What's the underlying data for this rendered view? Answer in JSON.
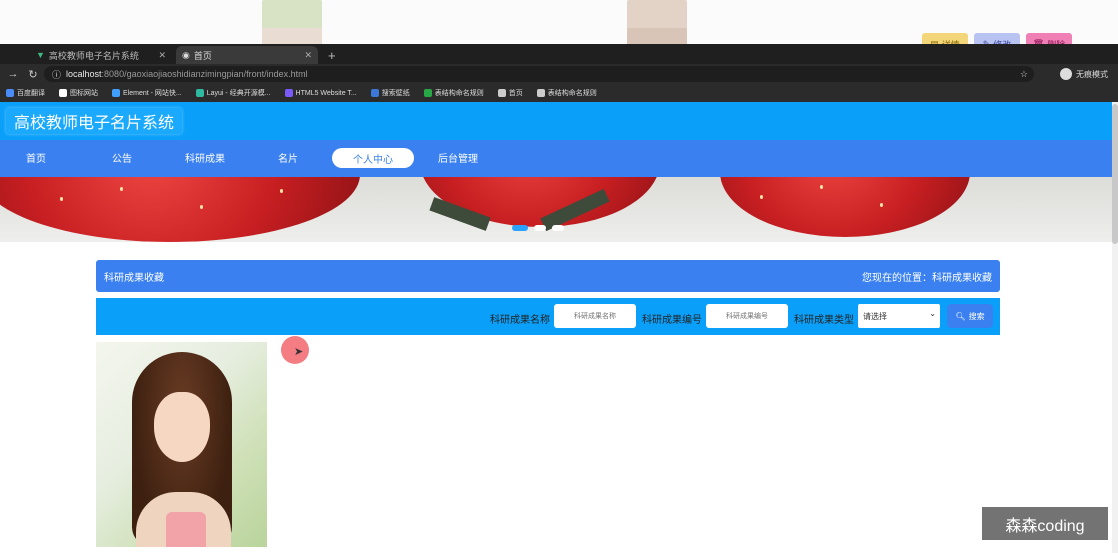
{
  "background_page": {
    "buttons": [
      {
        "label": "详情",
        "color": "#f3d57a"
      },
      {
        "label": "修改",
        "color": "#b9c3f2"
      },
      {
        "label": "删除",
        "color": "#f07fb6"
      }
    ]
  },
  "browser": {
    "tabs": [
      {
        "title": "高校教师电子名片系统",
        "active": false
      },
      {
        "title": "首页",
        "active": true
      }
    ],
    "new_tab_symbol": "+",
    "url_host": "localhost",
    "url_rest": ":8080/gaoxiaojiaoshidianzimingpian/front/index.html",
    "profile_label": "无痕模式",
    "bookmarks": [
      {
        "label": "百度翻译",
        "icon": "translate-icon",
        "color": "#4a8cf7"
      },
      {
        "label": "图标网站",
        "icon": "flag-icon",
        "color": "#ffffff"
      },
      {
        "label": "Element - 网站快...",
        "icon": "element-icon",
        "color": "#409eff"
      },
      {
        "label": "Layui - 经典开源模...",
        "icon": "layui-icon",
        "color": "#2fb9a0"
      },
      {
        "label": "HTML5 Website T...",
        "icon": "html5-icon",
        "color": "#7a5af8"
      },
      {
        "label": "搜索壁纸",
        "icon": "wallpaper-icon",
        "color": "#3c78d8"
      },
      {
        "label": "表结构命名规则",
        "icon": "table-icon",
        "color": "#28a745"
      },
      {
        "label": "首页",
        "icon": "globe-icon",
        "color": "#cccccc"
      },
      {
        "label": "表结构命名规则",
        "icon": "globe-icon",
        "color": "#cccccc"
      }
    ]
  },
  "site": {
    "title": "高校教师电子名片系统",
    "nav": [
      {
        "label": "首页",
        "active": false
      },
      {
        "label": "公告",
        "active": false
      },
      {
        "label": "科研成果",
        "active": false
      },
      {
        "label": "名片",
        "active": false
      },
      {
        "label": "个人中心",
        "active": true
      },
      {
        "label": "后台管理",
        "active": false
      }
    ],
    "carousel": {
      "slide_count": 3,
      "active_index": 0
    }
  },
  "page": {
    "heading": "科研成果收藏",
    "location": "您现在的位置：科研成果收藏",
    "search": {
      "name_label": "科研成果名称",
      "name_placeholder": "科研成果名称",
      "number_label": "科研成果编号",
      "number_placeholder": "科研成果编号",
      "type_label": "科研成果类型",
      "type_value": "请选择",
      "button_label": "搜索"
    }
  },
  "watermark": "森森coding",
  "colors": {
    "header": "#0aa0fa",
    "nav": "#3a80f0",
    "accent": "#3a80f0"
  }
}
